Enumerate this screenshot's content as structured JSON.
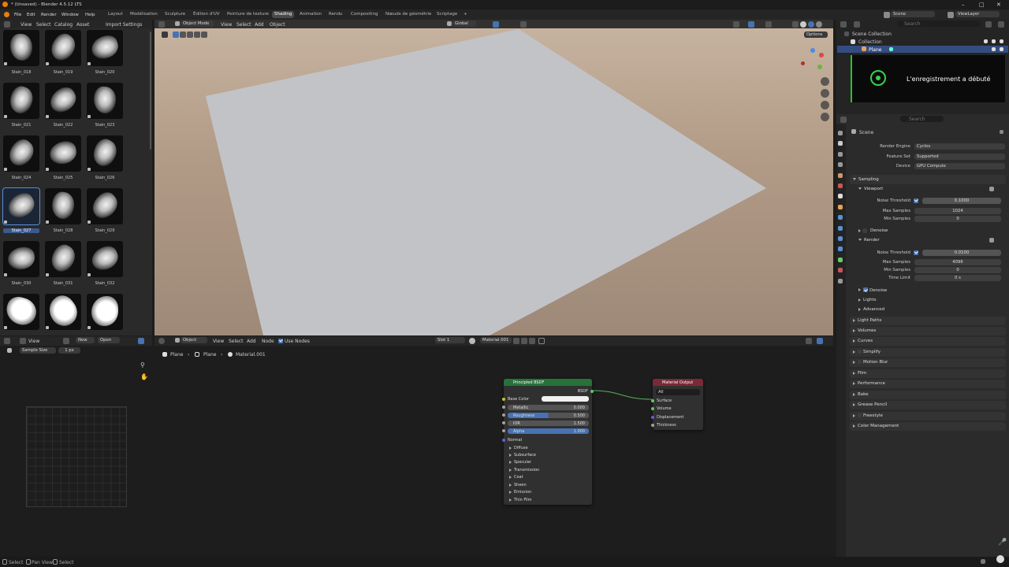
{
  "app": {
    "title": "* (Unsaved) - Blender 4.5.12 LTS"
  },
  "menubar": {
    "items": [
      "File",
      "Edit",
      "Render",
      "Window",
      "Help"
    ]
  },
  "workspaces": [
    "Layout",
    "Modélisation",
    "Sculpture",
    "Édition d'UV",
    "Peinture de texture",
    "Shading",
    "Animation",
    "Rendu",
    "Compositing",
    "Nœuds de géométrie",
    "Scriptage"
  ],
  "active_workspace": "Shading",
  "scene_field": "Scene",
  "viewlayer_field": "ViewLayer",
  "asset_browser": {
    "menus": [
      "View",
      "Select",
      "Catalog",
      "Asset"
    ],
    "import_label": "Import Settings",
    "assets": [
      "Stain_018",
      "Stain_019",
      "Stain_020",
      "Stain_021",
      "Stain_022",
      "Stain_023",
      "Stain_024",
      "Stain_025",
      "Stain_026",
      "Stain_027",
      "Stain_028",
      "Stain_029",
      "Stain_030",
      "Stain_031",
      "Stain_032",
      "",
      "",
      ""
    ],
    "selected": "Stain_027"
  },
  "viewport": {
    "mode": "Object Mode",
    "menus": [
      "View",
      "Select",
      "Add",
      "Object"
    ],
    "orientation": "Global",
    "options_label": "Options"
  },
  "node_editor": {
    "type": "Object",
    "menus": [
      "View",
      "Select",
      "Add",
      "Node"
    ],
    "use_nodes_label": "Use Nodes",
    "slot": "Slot 1",
    "material": "Material.001",
    "breadcrumb": [
      "Plane",
      "Plane",
      "Material.001"
    ],
    "bsdf": {
      "title": "Principled BSDF",
      "output": "BSDF",
      "base_color": "Base Color",
      "fields": [
        {
          "label": "Metallic",
          "value": "0.000",
          "fill": 0.0
        },
        {
          "label": "Roughness",
          "value": "0.500",
          "fill": 0.5
        },
        {
          "label": "IOR",
          "value": "1.500",
          "fill": 0.0
        },
        {
          "label": "Alpha",
          "value": "1.000",
          "fill": 1.0
        }
      ],
      "normal": "Normal",
      "panels": [
        "Diffuse",
        "Subsurface",
        "Specular",
        "Transmission",
        "Coat",
        "Sheen",
        "Emission",
        "Thin Film"
      ]
    },
    "output": {
      "title": "Material Output",
      "target": "All",
      "inputs": [
        "Surface",
        "Volume",
        "Displacement",
        "Thickness"
      ]
    }
  },
  "image_editor": {
    "view_label": "View",
    "new_label": "New",
    "open_label": "Open",
    "tool_label": "Sample Size",
    "tool_value": "1 px"
  },
  "outliner": {
    "search_placeholder": "Search",
    "items": [
      "Scene Collection",
      "Collection",
      "Plane"
    ],
    "notification": "L'enregistrement a débuté"
  },
  "properties": {
    "search_placeholder": "Search",
    "context": "Scene",
    "render_engine": {
      "label": "Render Engine",
      "value": "Cycles"
    },
    "feature_set": {
      "label": "Feature Set",
      "value": "Supported"
    },
    "device": {
      "label": "Device",
      "value": "GPU Compute"
    },
    "sampling": "Sampling",
    "viewport": "Viewport",
    "vp_noise": {
      "label": "Noise Threshold",
      "value": "0.1000"
    },
    "vp_max": {
      "label": "Max Samples",
      "value": "1024"
    },
    "vp_min": {
      "label": "Min Samples",
      "value": "0"
    },
    "denoise_vp": "Denoise",
    "render": "Render",
    "r_noise": {
      "label": "Noise Threshold",
      "value": "0.0100"
    },
    "r_max": {
      "label": "Max Samples",
      "value": "4096"
    },
    "r_min": {
      "label": "Min Samples",
      "value": "0"
    },
    "r_time": {
      "label": "Time Limit",
      "value": "0 s"
    },
    "denoise_r": "Denoise",
    "lights": "Lights",
    "advanced": "Advanced",
    "sections": [
      "Light Paths",
      "Volumes",
      "Curves",
      "Simplify",
      "Motion Blur",
      "Film",
      "Performance",
      "Bake",
      "Grease Pencil",
      "Freestyle",
      "Color Management"
    ]
  },
  "statusbar": {
    "items": [
      "Select",
      "Pan View",
      "Select"
    ]
  }
}
